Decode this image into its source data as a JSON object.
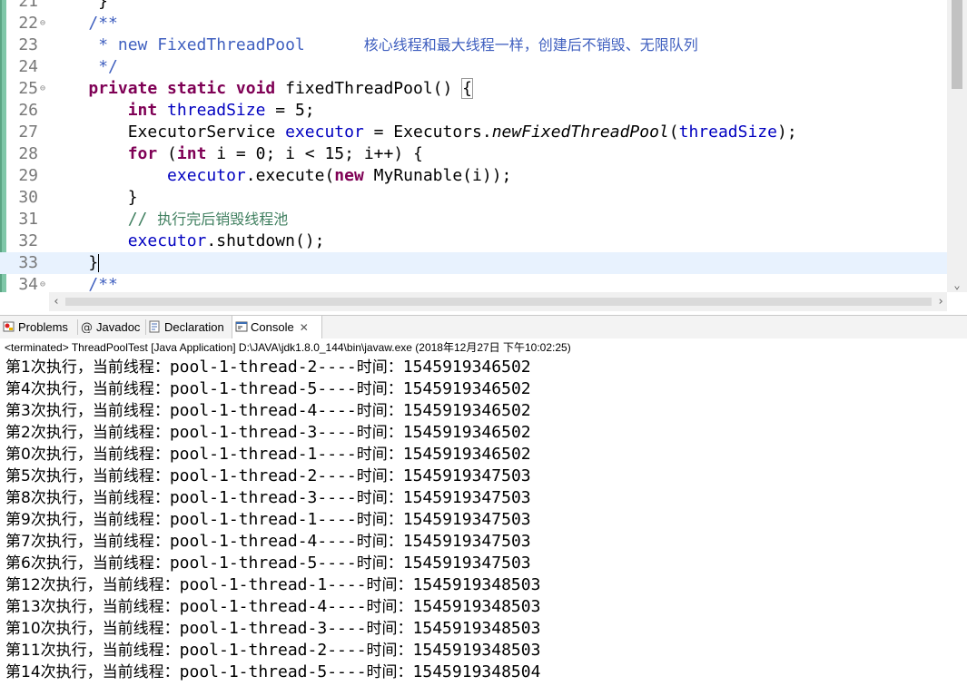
{
  "editor": {
    "lines": [
      {
        "num": "21",
        "fold": false,
        "html": "     }"
      },
      {
        "num": "22",
        "fold": true,
        "html": "    <span class='jdoc'>/**</span>"
      },
      {
        "num": "23",
        "fold": false,
        "html": "     <span class='jdoc'>* new FixedThreadPool      </span><span class='jdoc cjk'>核心线程和最大线程一样，创建后不销毁、无限队列</span>"
      },
      {
        "num": "24",
        "fold": false,
        "html": "     <span class='jdoc'>*/</span>"
      },
      {
        "num": "25",
        "fold": true,
        "html": "    <span class='kw'>private static void</span> fixedThreadPool() <span class='brace-box'>{</span>"
      },
      {
        "num": "26",
        "fold": false,
        "html": "        <span class='kw'>int</span> <span class='fld'>threadSize</span> = 5;"
      },
      {
        "num": "27",
        "fold": false,
        "html": "        ExecutorService <span class='fld'>executor</span> = Executors.<span class='ital'>newFixedThreadPool</span>(<span class='fld'>threadSize</span>);"
      },
      {
        "num": "28",
        "fold": false,
        "html": "        <span class='kw'>for</span> (<span class='kw'>int</span> i = 0; i &lt; 15; i++) {"
      },
      {
        "num": "29",
        "fold": false,
        "html": "            <span class='fld'>executor</span>.execute(<span class='kw'>new</span> MyRunable(i));"
      },
      {
        "num": "30",
        "fold": false,
        "html": "        }"
      },
      {
        "num": "31",
        "fold": false,
        "html": "        <span class='cmt'>// </span><span class='cmt cjk'>执行完后销毁线程池</span>"
      },
      {
        "num": "32",
        "fold": false,
        "html": "        <span class='fld'>executor</span>.shutdown();"
      },
      {
        "num": "33",
        "fold": false,
        "html": "    }<span class='caret'></span>"
      },
      {
        "num": "34",
        "fold": true,
        "html": "    <span class='jdoc'>/**</span>"
      }
    ]
  },
  "tabs": [
    {
      "label": "Problems",
      "icon": "problems-icon"
    },
    {
      "label": "Javadoc",
      "icon": "javadoc-icon"
    },
    {
      "label": "Declaration",
      "icon": "declaration-icon"
    },
    {
      "label": "Console",
      "icon": "console-icon",
      "active": true,
      "close": "✕"
    }
  ],
  "console": {
    "header": "<terminated> ThreadPoolTest [Java Application] D:\\JAVA\\jdk1.8.0_144\\bin\\javaw.exe (2018年12月27日 下午10:02:25)",
    "output": [
      {
        "pre": "第1次执行，当前线程：",
        "thread": "pool-1-thread-2----",
        "mid": "时间：",
        "time": "1545919346502"
      },
      {
        "pre": "第4次执行，当前线程：",
        "thread": "pool-1-thread-5----",
        "mid": "时间：",
        "time": "1545919346502"
      },
      {
        "pre": "第3次执行，当前线程：",
        "thread": "pool-1-thread-4----",
        "mid": "时间：",
        "time": "1545919346502"
      },
      {
        "pre": "第2次执行，当前线程：",
        "thread": "pool-1-thread-3----",
        "mid": "时间：",
        "time": "1545919346502"
      },
      {
        "pre": "第0次执行，当前线程：",
        "thread": "pool-1-thread-1----",
        "mid": "时间：",
        "time": "1545919346502"
      },
      {
        "pre": "第5次执行，当前线程：",
        "thread": "pool-1-thread-2----",
        "mid": "时间：",
        "time": "1545919347503"
      },
      {
        "pre": "第8次执行，当前线程：",
        "thread": "pool-1-thread-3----",
        "mid": "时间：",
        "time": "1545919347503"
      },
      {
        "pre": "第9次执行，当前线程：",
        "thread": "pool-1-thread-1----",
        "mid": "时间：",
        "time": "1545919347503"
      },
      {
        "pre": "第7次执行，当前线程：",
        "thread": "pool-1-thread-4----",
        "mid": "时间：",
        "time": "1545919347503"
      },
      {
        "pre": "第6次执行，当前线程：",
        "thread": "pool-1-thread-5----",
        "mid": "时间：",
        "time": "1545919347503"
      },
      {
        "pre": "第12次执行，当前线程：",
        "thread": "pool-1-thread-1----",
        "mid": "时间：",
        "time": "1545919348503"
      },
      {
        "pre": "第13次执行，当前线程：",
        "thread": "pool-1-thread-4----",
        "mid": "时间：",
        "time": "1545919348503"
      },
      {
        "pre": "第10次执行，当前线程：",
        "thread": "pool-1-thread-3----",
        "mid": "时间：",
        "time": "1545919348503"
      },
      {
        "pre": "第11次执行，当前线程：",
        "thread": "pool-1-thread-2----",
        "mid": "时间：",
        "time": "1545919348503"
      },
      {
        "pre": "第14次执行，当前线程：",
        "thread": "pool-1-thread-5----",
        "mid": "时间：",
        "time": "1545919348504"
      }
    ]
  },
  "colors": {
    "keyword": "#7f0055",
    "field": "#0000c0",
    "javadoc": "#3f5fbf",
    "comment": "#3f7f5f",
    "current_line": "#e8f2fe"
  }
}
